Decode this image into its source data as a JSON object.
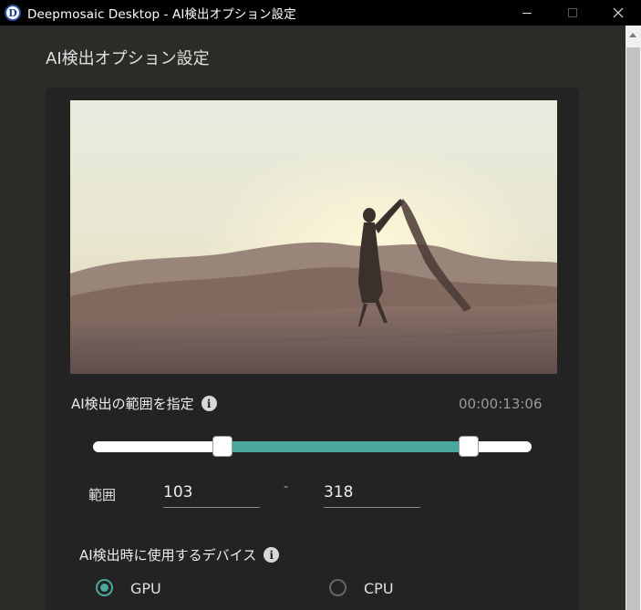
{
  "window": {
    "title": "Deepmosaic Desktop - AI検出オプション設定",
    "app_icon_letter": "D"
  },
  "page": {
    "title": "AI検出オプション設定"
  },
  "preview": {
    "icon": "desert-scene-image"
  },
  "range": {
    "label": "AI検出の範囲を指定",
    "info_icon": "i",
    "timecode": "00:00:13:06",
    "slider": {
      "min": 0,
      "max": 360,
      "start": 103,
      "end": 318,
      "accent": "#4aa89b"
    },
    "fields_label": "範囲",
    "start_value": "103",
    "separator": "-",
    "end_value": "318"
  },
  "device": {
    "label": "AI検出時に使用するデバイス",
    "info_icon": "i",
    "options": [
      {
        "label": "GPU",
        "selected": true
      },
      {
        "label": "CPU",
        "selected": false
      }
    ]
  }
}
